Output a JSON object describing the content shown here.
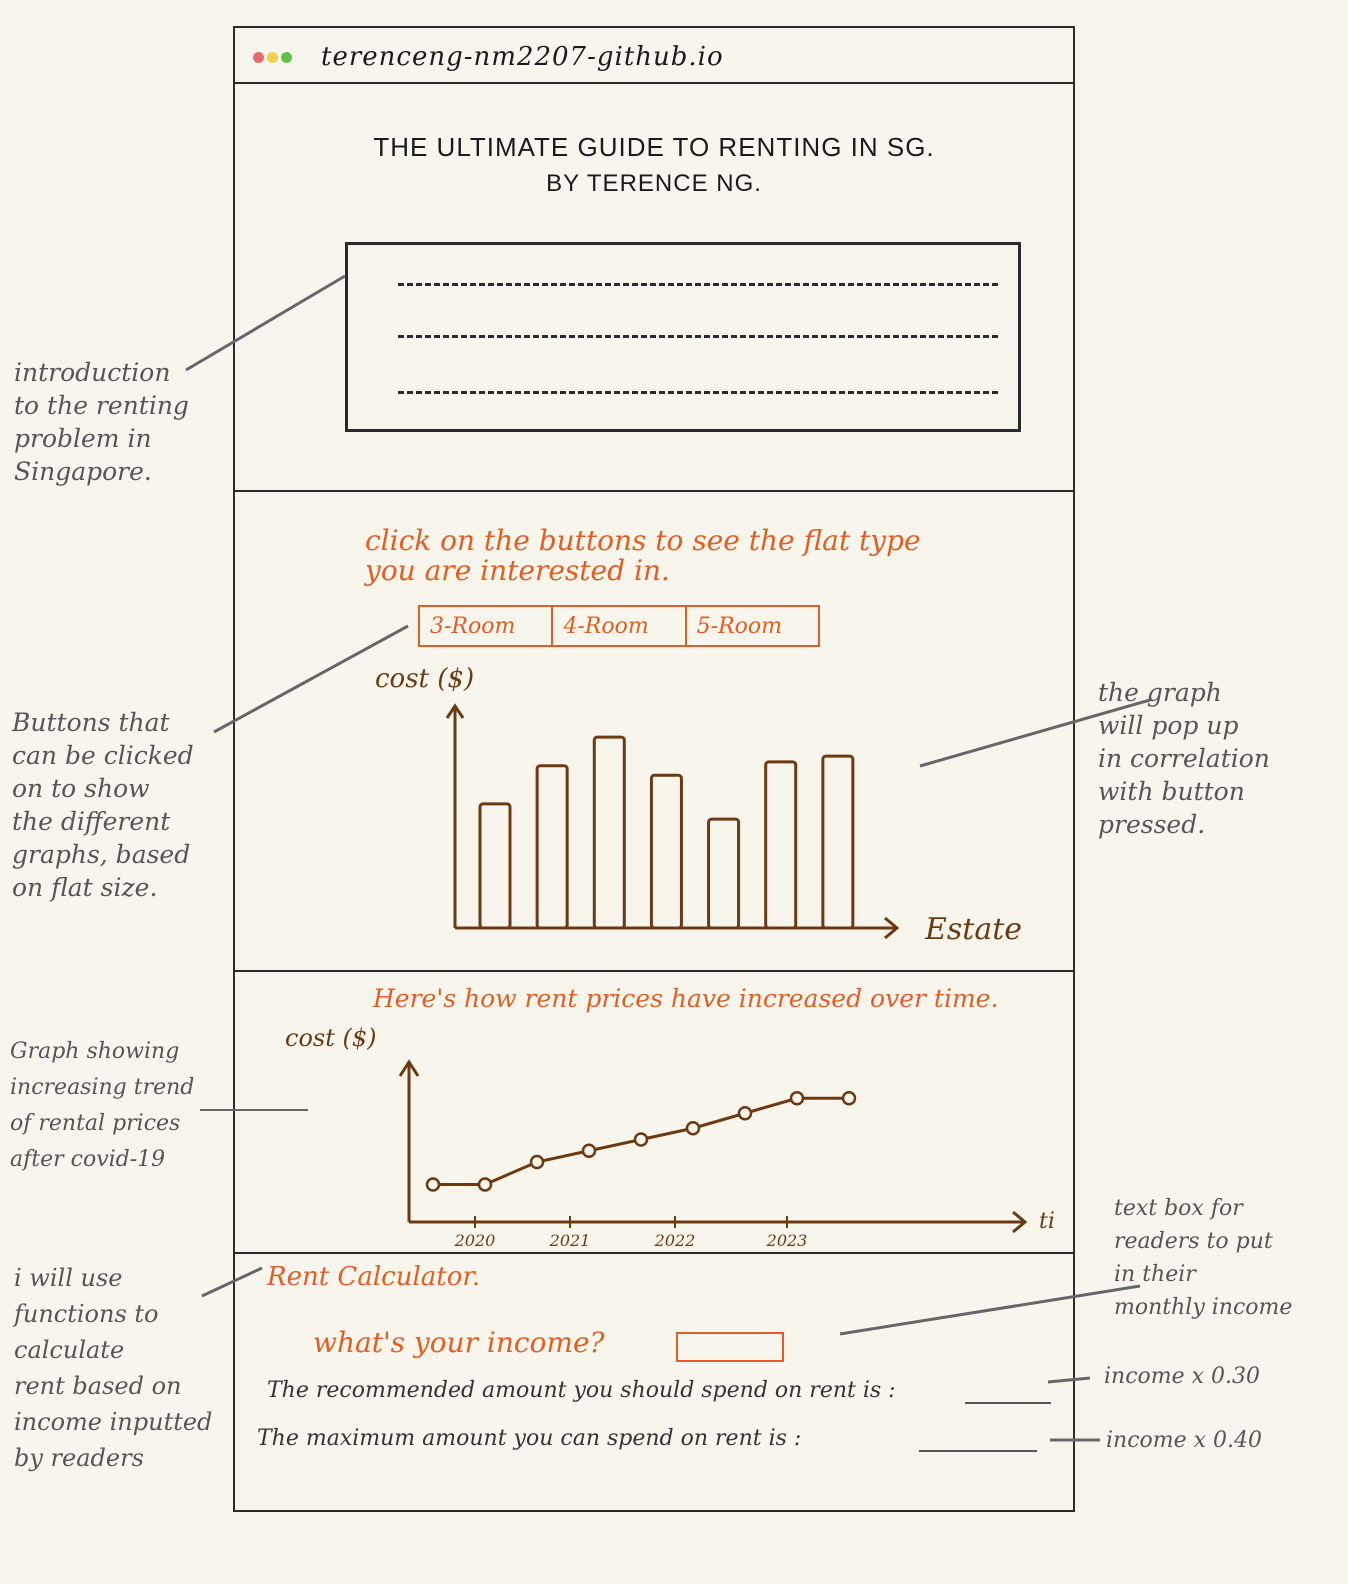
{
  "browser": {
    "url": "terenceng-nm2207-github.io",
    "dots": [
      "#e86a6a",
      "#f0d14a",
      "#5dc24a"
    ]
  },
  "header": {
    "title": "THE ULTIMATE GUIDE TO RENTING IN SG.",
    "byline": "BY TERENCE NG."
  },
  "flat_section": {
    "prompt_line1": "click on the buttons to see the flat type",
    "prompt_line2": "you are interested in.",
    "buttons": [
      {
        "label": "3-Room"
      },
      {
        "label": "4-Room"
      },
      {
        "label": "5-Room"
      }
    ]
  },
  "trend_section": {
    "prompt": "Here's how rent prices have increased over time."
  },
  "calculator": {
    "title": "Rent Calculator.",
    "income_question": "what's your income?",
    "income_value": "",
    "recommended_text": "The recommended amount you should spend on rent is :",
    "maximum_text": "The maximum amount you can spend on rent is :"
  },
  "annotations": {
    "intro": [
      "introduction",
      "to the renting",
      "problem in",
      "Singapore."
    ],
    "buttons": [
      "Buttons that",
      "can be clicked",
      "on to show",
      "the different",
      "graphs, based",
      "on flat size."
    ],
    "graph_popup": [
      "the graph",
      "will pop up",
      "in correlation",
      "with button",
      "pressed."
    ],
    "trend": [
      "Graph showing",
      "increasing trend",
      "of rental prices",
      "after covid-19"
    ],
    "functions": [
      "i will use",
      "functions to",
      "calculate",
      "rent based on",
      "income inputted",
      "by readers"
    ],
    "textbox": [
      "text box for",
      "readers to put",
      "in their",
      "monthly income"
    ],
    "rec_formula": "income x 0.30",
    "max_formula": "income x 0.40"
  },
  "chart_data": [
    {
      "type": "bar",
      "ylabel": "cost ($)",
      "xlabel": "Estate",
      "values": [
        65,
        85,
        100,
        80,
        57,
        87,
        90
      ],
      "ylim": [
        0,
        110
      ],
      "color": "#6b3a12"
    },
    {
      "type": "line",
      "ylabel": "cost ($)",
      "xlabel": "time",
      "x_ticks": [
        "2020",
        "2021",
        "2022",
        "2023"
      ],
      "values": [
        10,
        10,
        16,
        19,
        22,
        25,
        29,
        33,
        33
      ],
      "ylim": [
        0,
        40
      ],
      "color": "#6b3a12"
    }
  ]
}
